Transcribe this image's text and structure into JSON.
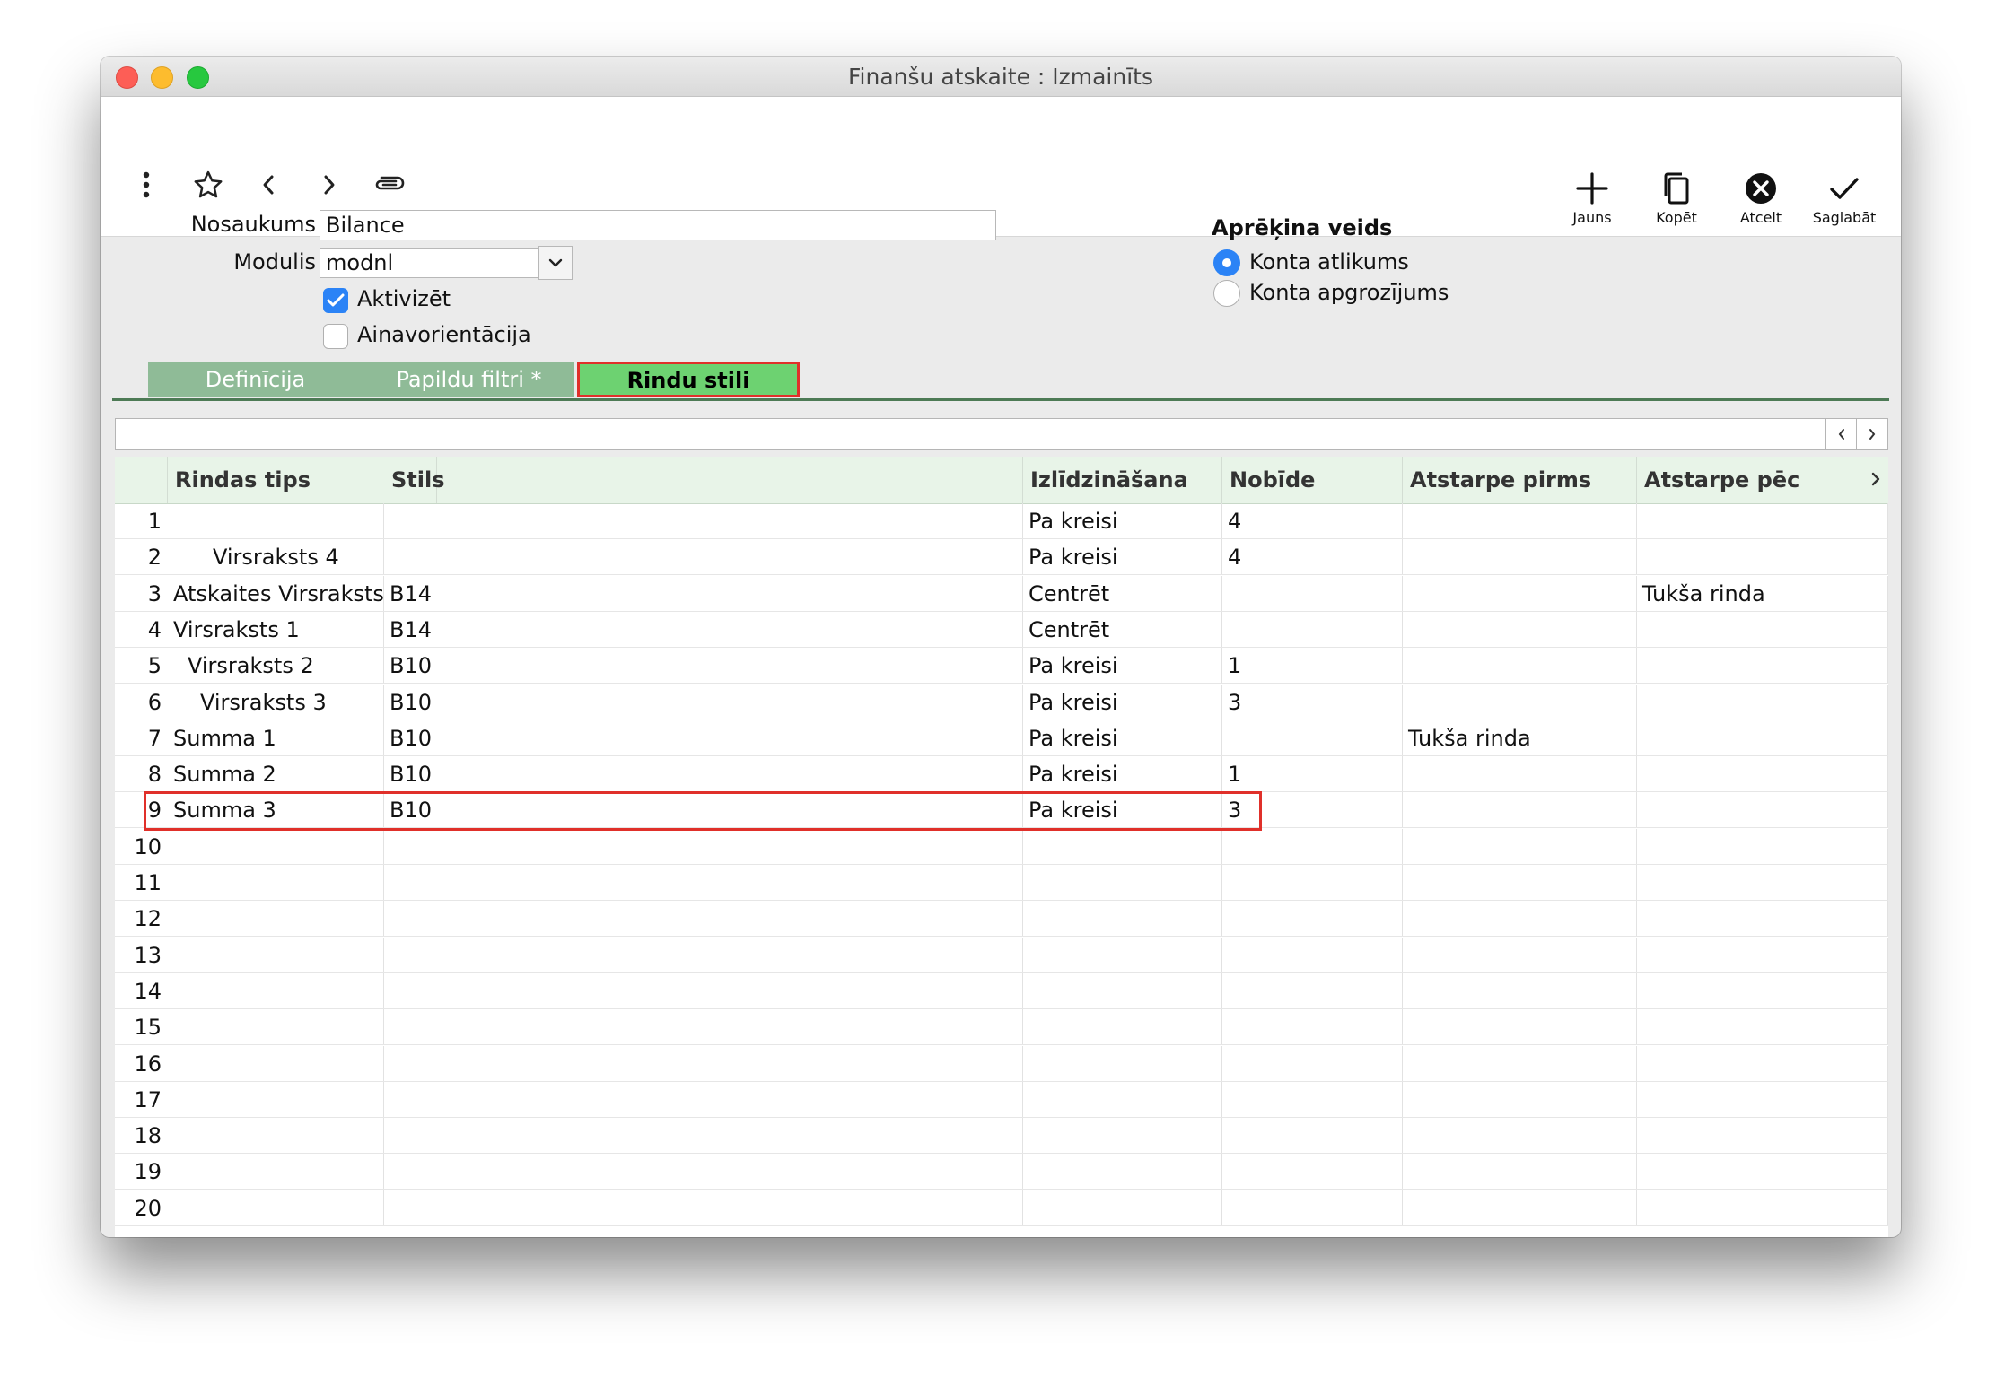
{
  "window": {
    "title": "Finanšu atskaite : Izmainīts"
  },
  "toolbar": {
    "left_icons": [
      "more-vertical-icon",
      "star-icon",
      "chevron-left-icon",
      "chevron-right-icon",
      "paperclip-icon"
    ],
    "new_label": "Jauns",
    "copy_label": "Kopēt",
    "cancel_label": "Atcelt",
    "save_label": "Saglabāt"
  },
  "form": {
    "name_label": "Nosaukums",
    "name_value": "Bilance",
    "module_label": "Modulis",
    "module_value": "modnl",
    "activate_label": "Aktivizēt",
    "activate_checked": true,
    "landscape_label": "Ainavorientācija",
    "landscape_checked": false
  },
  "calc": {
    "title": "Aprēķina veids",
    "options": [
      "Konta atlikums",
      "Konta apgrozījums"
    ],
    "selected": "Konta atlikums"
  },
  "tabs": [
    {
      "label": "Definīcija",
      "active": false
    },
    {
      "label": "Papildu filtri *",
      "active": false
    },
    {
      "label": "Rindu stili",
      "active": true
    }
  ],
  "colors": {
    "tab": "#8fbb97",
    "tab_active": "#6dd271",
    "accent": "#2b83f6",
    "highlight": "#e0302a"
  },
  "grid": {
    "columns": [
      "Rindas tips",
      "Stils",
      "Izlīdzināšana",
      "Nobīde",
      "Atstarpe pirms",
      "Atstarpe pēc"
    ],
    "rows": [
      {
        "n": "1",
        "type": "",
        "style": "",
        "align": "Pa kreisi",
        "indent": "4",
        "before": "",
        "after": ""
      },
      {
        "n": "2",
        "type": "Virsraksts 4",
        "style": "",
        "align": "Pa kreisi",
        "indent": "4",
        "before": "",
        "after": ""
      },
      {
        "n": "3",
        "type": "Atskaites Virsraksts",
        "style": "B14",
        "align": "Centrēt",
        "indent": "",
        "before": "",
        "after": "Tukša rinda"
      },
      {
        "n": "4",
        "type": "Virsraksts 1",
        "style": "B14",
        "align": "Centrēt",
        "indent": "",
        "before": "",
        "after": ""
      },
      {
        "n": "5",
        "type": "Virsraksts 2",
        "style": "B10",
        "align": "Pa kreisi",
        "indent": "1",
        "before": "",
        "after": ""
      },
      {
        "n": "6",
        "type": "Virsraksts 3",
        "style": "B10",
        "align": "Pa kreisi",
        "indent": "3",
        "before": "",
        "after": ""
      },
      {
        "n": "7",
        "type": "Summa 1",
        "style": "B10",
        "align": "Pa kreisi",
        "indent": "",
        "before": "Tukša rinda",
        "after": ""
      },
      {
        "n": "8",
        "type": "Summa 2",
        "style": "B10",
        "align": "Pa kreisi",
        "indent": "1",
        "before": "",
        "after": ""
      },
      {
        "n": "9",
        "type": "Summa 3",
        "style": "B10",
        "align": "Pa kreisi",
        "indent": "3",
        "before": "",
        "after": ""
      },
      {
        "n": "10",
        "type": "",
        "style": "",
        "align": "",
        "indent": "",
        "before": "",
        "after": ""
      },
      {
        "n": "11",
        "type": "",
        "style": "",
        "align": "",
        "indent": "",
        "before": "",
        "after": ""
      },
      {
        "n": "12",
        "type": "",
        "style": "",
        "align": "",
        "indent": "",
        "before": "",
        "after": ""
      },
      {
        "n": "13",
        "type": "",
        "style": "",
        "align": "",
        "indent": "",
        "before": "",
        "after": ""
      },
      {
        "n": "14",
        "type": "",
        "style": "",
        "align": "",
        "indent": "",
        "before": "",
        "after": ""
      },
      {
        "n": "15",
        "type": "",
        "style": "",
        "align": "",
        "indent": "",
        "before": "",
        "after": ""
      },
      {
        "n": "16",
        "type": "",
        "style": "",
        "align": "",
        "indent": "",
        "before": "",
        "after": ""
      },
      {
        "n": "17",
        "type": "",
        "style": "",
        "align": "",
        "indent": "",
        "before": "",
        "after": ""
      },
      {
        "n": "18",
        "type": "",
        "style": "",
        "align": "",
        "indent": "",
        "before": "",
        "after": ""
      },
      {
        "n": "19",
        "type": "",
        "style": "",
        "align": "",
        "indent": "",
        "before": "",
        "after": ""
      },
      {
        "n": "20",
        "type": "",
        "style": "",
        "align": "",
        "indent": "",
        "before": "",
        "after": ""
      }
    ]
  }
}
